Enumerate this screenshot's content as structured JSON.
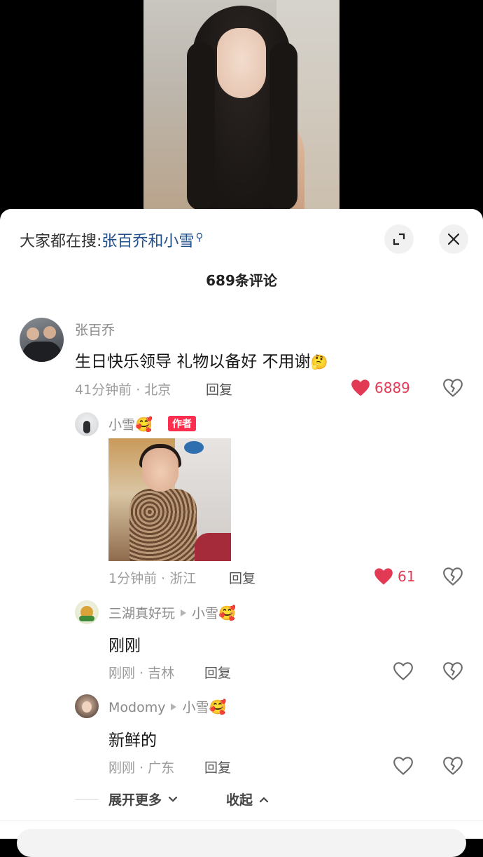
{
  "video": {
    "label": ""
  },
  "header": {
    "search_prefix": "大家都在搜:",
    "search_term": "张百乔和小雪",
    "comment_count": "689条评论"
  },
  "comments": [
    {
      "username": "张百乔",
      "text": "生日快乐领导 礼物以备好 不用谢",
      "time_location": "41分钟前 · 北京",
      "reply_label": "回复",
      "likes": "6889",
      "liked": true
    }
  ],
  "replies": [
    {
      "username": "小雪",
      "badge": "作者",
      "time_location": "1分钟前 · 浙江",
      "reply_label": "回复",
      "likes": "61",
      "liked": true,
      "has_sticker": true
    },
    {
      "username": "三湖真好玩",
      "reply_to": "小雪",
      "text": "刚刚",
      "time_location": "刚刚 · 吉林",
      "reply_label": "回复"
    },
    {
      "username": "Modomy",
      "reply_to": "小雪",
      "text": "新鲜的",
      "time_location": "刚刚 · 广东",
      "reply_label": "回复"
    }
  ],
  "thread_controls": {
    "expand_label": "展开更多",
    "collapse_label": "收起"
  },
  "colors": {
    "like_red": "#e23a55",
    "author_badge": "#ff2e4e",
    "search_term": "#1f4e8c"
  },
  "icons": [
    "search-icon",
    "expand-icon",
    "close-icon",
    "heart-icon",
    "broken-heart-icon",
    "chevron-down-icon",
    "chevron-up-icon"
  ]
}
